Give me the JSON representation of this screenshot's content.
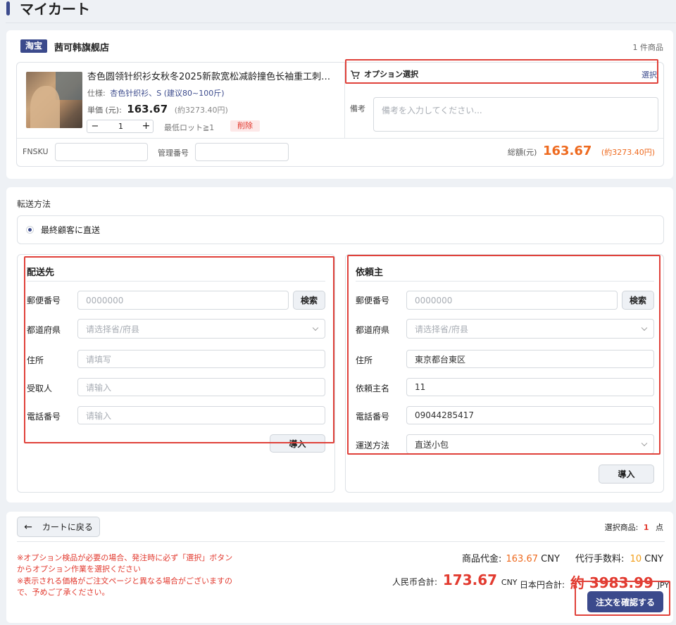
{
  "page_title": "マイカート",
  "shop": {
    "badge": "淘宝",
    "name": "茜可韩旗舰店",
    "count": "1 件商品"
  },
  "product": {
    "title": "杏色圆领针织衫女秋冬2025新款宽松减龄撞色长袖重工刺…",
    "spec_label": "仕様:",
    "spec_value": "杏色针织衫、S (建议80~100斤)",
    "unit_label": "単価 (元):",
    "unit_price": "163.67",
    "unit_jpy": "(約3273.40円)",
    "qty": "1",
    "minus": "−",
    "plus": "+",
    "min_lot": "最低ロット≧1",
    "delete": "削除"
  },
  "option": {
    "label": "オプション選択",
    "select": "選択"
  },
  "memo": {
    "label": "備考",
    "placeholder": "備考を入力してください..."
  },
  "fnsku_label": "FNSKU",
  "manage_label": "管理番号",
  "total": {
    "label": "総額(元)",
    "value": "163.67",
    "jpy": "(約3273.40円)"
  },
  "shipping": {
    "title": "転送方法",
    "option": "最終顧客に直送"
  },
  "delivery": {
    "title": "配送先",
    "postal_label": "郵便番号",
    "postal_ph": "0000000",
    "search": "検索",
    "pref_label": "都道府県",
    "pref_ph": "请选择省/府县",
    "address_label": "住所",
    "address_ph": "请填写",
    "recipient_label": "受取人",
    "recipient_ph": "请输入",
    "phone_label": "電話番号",
    "phone_ph": "请输入",
    "import": "導入"
  },
  "requester": {
    "title": "依頼主",
    "postal_label": "郵便番号",
    "postal_ph": "0000000",
    "search": "検索",
    "pref_label": "都道府県",
    "pref_ph": "请选择省/府县",
    "address_label": "住所",
    "address_value": "東京都台東区",
    "name_label": "依頼主名",
    "name_value": "11",
    "phone_label": "電話番号",
    "phone_value": "09044285417",
    "method_label": "運送方法",
    "method_value": "直送小包",
    "import": "導入"
  },
  "footer": {
    "back": "カートに戻る",
    "selected_label": "選択商品:",
    "selected_count": "1",
    "selected_unit": "点",
    "note1": "※オプション検品が必要の場合、発注時に必ず「選択」ボタン",
    "note2": "からオプション作業を選択ください",
    "note3": "※表示される価格がご注文ページと異なる場合がございますの",
    "note4": "で、予めご了承ください。",
    "goods_label": "商品代金:",
    "goods_value": "163.67",
    "goods_unit": "CNY",
    "fee_label": "代行手数料:",
    "fee_value": "10",
    "fee_unit": "CNY",
    "rmb_label": "人民币合計:",
    "rmb_value": "173.67",
    "rmb_unit": "CNY",
    "jpy_label": "日本円合計:",
    "jpy_value": "約 3983.99",
    "jpy_unit": "JPY",
    "confirm": "注文を確認する"
  }
}
